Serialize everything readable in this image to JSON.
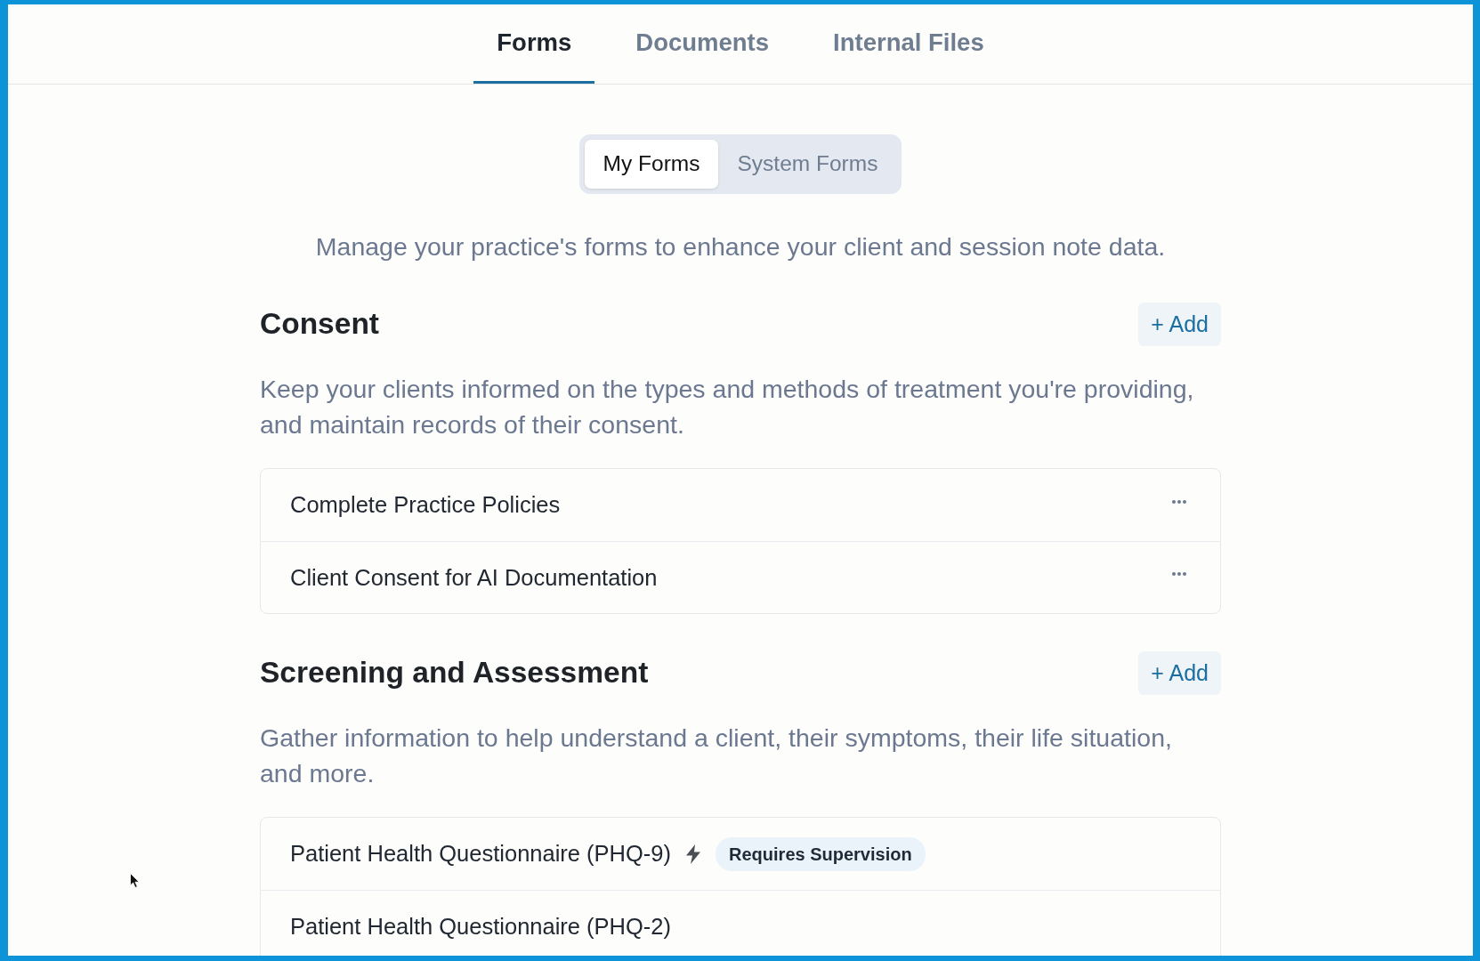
{
  "tabs": [
    {
      "label": "Forms",
      "selected": true
    },
    {
      "label": "Documents",
      "selected": false
    },
    {
      "label": "Internal Files",
      "selected": false
    }
  ],
  "form_source_toggle": [
    {
      "label": "My Forms",
      "selected": true
    },
    {
      "label": "System Forms",
      "selected": false
    }
  ],
  "intro": "Manage your practice's forms to enhance your client and session note data.",
  "sections": [
    {
      "title": "Consent",
      "add_button": "+ Add",
      "description": "Keep your clients informed on the types and methods of treatment you're providing, and maintain records of their consent.",
      "forms": [
        {
          "name": "Complete Practice Policies",
          "menu_button": true,
          "bolt": false
        },
        {
          "name": "Client Consent for AI Documentation",
          "menu_button": true,
          "bolt": false
        }
      ]
    },
    {
      "title": "Screening and Assessment",
      "add_button": "+ Add",
      "description": "Gather information to help understand a client, their symptoms, their life situation, and more.",
      "forms": [
        {
          "name": "Patient Health Questionnaire (PHQ-9)",
          "menu_button": false,
          "bolt": true,
          "badge": "Requires Supervision"
        },
        {
          "name": "Patient Health Questionnaire (PHQ-2)",
          "menu_button": false,
          "bolt": false
        }
      ]
    }
  ]
}
